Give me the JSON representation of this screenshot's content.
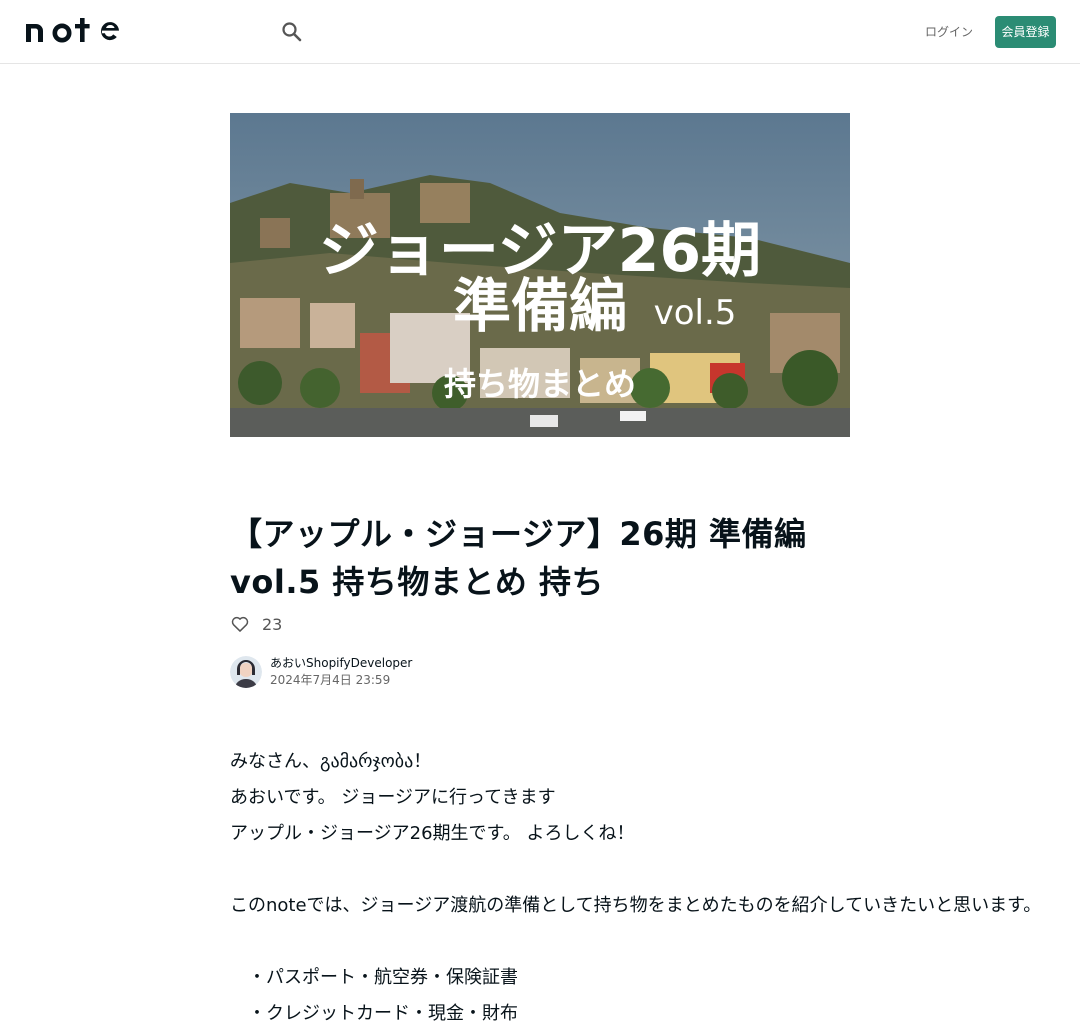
{
  "header": {
    "logo_text": "note",
    "login_label": "ログイン",
    "signup_label": "会員登録"
  },
  "hero": {
    "line1": "ジョージア26期",
    "line2": "準備編",
    "vol": "vol.5",
    "line3": "持ち物まとめ"
  },
  "article": {
    "title": "【アップル・ジョージア】26期 準備編vol.5 持ち物まとめ 持ち",
    "like_count": "23",
    "author_name": "あおいShopifyDeveloper",
    "date": "2024年7月4日 23:59",
    "body": [
      "みなさん、გამარჯობა！",
      "あおいです。 ジョージアに行ってきます",
      "アップル・ジョージア26期生です。 よろしくね！",
      "",
      "このnoteでは、ジョージア渡航の準備として持ち物をまとめたものを紹介していきたいと思います。",
      "",
      "・パスポート・航空券・保険証書",
      "・クレジットカード・現金・財布"
    ]
  },
  "colors": {
    "accent": "#2b8c74",
    "text": "#08131a"
  },
  "icons": {
    "search": "search-icon",
    "like": "heart-icon"
  }
}
